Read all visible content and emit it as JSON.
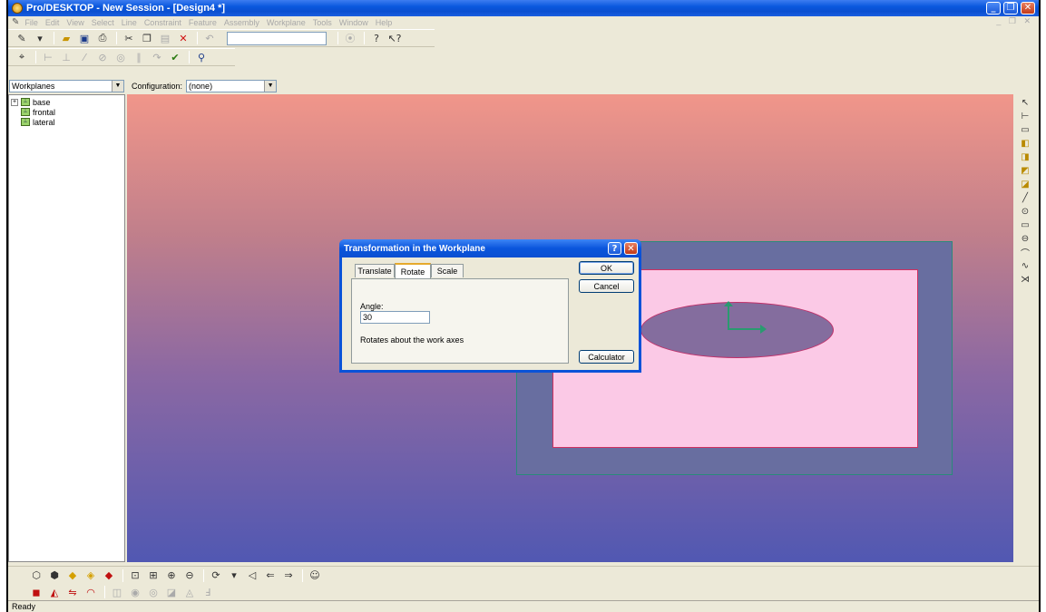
{
  "window": {
    "title": "Pro/DESKTOP - New Session - [Design4 *]",
    "controls": [
      "_",
      "❐",
      "✕"
    ]
  },
  "menubar": {
    "items": [
      "File",
      "Edit",
      "View",
      "Select",
      "Line",
      "Constraint",
      "Feature",
      "Assembly",
      "Workplane",
      "Tools",
      "Window",
      "Help"
    ],
    "mdi_controls": "_ ❐ ✕"
  },
  "selection": {
    "browser_mode": "Workplanes",
    "configuration_label": "Configuration:",
    "configuration_value": "(none)"
  },
  "tree": {
    "items": [
      {
        "label": "base",
        "expandable": true
      },
      {
        "label": "frontal",
        "expandable": false
      },
      {
        "label": "lateral",
        "expandable": false
      }
    ]
  },
  "dialog": {
    "title": "Transformation in the Workplane",
    "help_glyph": "?",
    "close_glyph": "✕",
    "tabs": [
      "Translate",
      "Rotate",
      "Scale"
    ],
    "active_tab": "Rotate",
    "angle_label": "Angle:",
    "angle_value": "30",
    "description": "Rotates about the work axes",
    "ok_label": "OK",
    "cancel_label": "Cancel",
    "calculator_label": "Calculator"
  },
  "status": {
    "text": "Ready"
  },
  "colors": {
    "viewport_top": "#f1968a",
    "viewport_bottom": "#5158b2",
    "title_blue": "#0a52d8",
    "sketch_outer": "#686ea0",
    "sketch_inner": "#fbc9e6",
    "axes": "#2a9a70"
  }
}
